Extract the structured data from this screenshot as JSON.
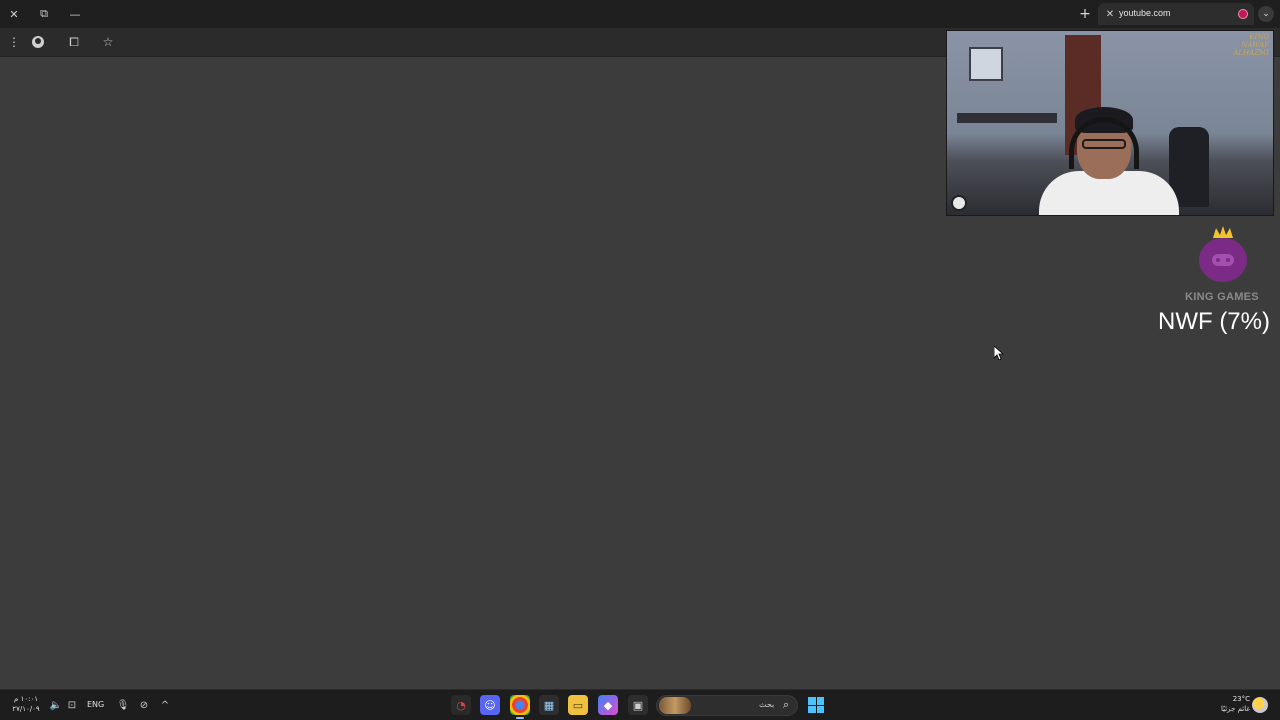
{
  "browser": {
    "tab": {
      "title": "youtube.com",
      "close_icon": "close-icon",
      "favicon": "youtube-favicon"
    },
    "window_controls": {
      "close": "✕",
      "restore": "⧉",
      "minimize": "—"
    },
    "new_tab": "+",
    "tab_list": "⌄",
    "toolbar": {
      "menu": "⋮",
      "profile": "profile-icon",
      "extensions": "⧠",
      "bookmark": "☆"
    }
  },
  "overlay": {
    "webcam_signature": "KING NAWAF ALHAZMI",
    "logo_text": "KING GAMES",
    "status_text": "NWF (7%)"
  },
  "taskbar": {
    "clock_time": "١٠:٠١ م",
    "clock_date": "٢٧/١٠/٠٩",
    "language": "ENG",
    "search_label": "بحث",
    "search_glass": "⌕",
    "weather_temp": "23°C",
    "weather_desc": "غائم جزئيًا",
    "up_arrow": "^",
    "mic": "🎙",
    "volume": "🔈",
    "network": "⊡",
    "camera_off": "⊘"
  },
  "colors": {
    "page_bg": "#3c3c3c",
    "titlebar": "#1f1f1f",
    "toolbar": "#2b2b2b",
    "taskbar": "#1d1d1d",
    "logo_purple": "#7b2a86",
    "crown_gold": "#f2c230",
    "start_blue": "#4cc2ff"
  }
}
